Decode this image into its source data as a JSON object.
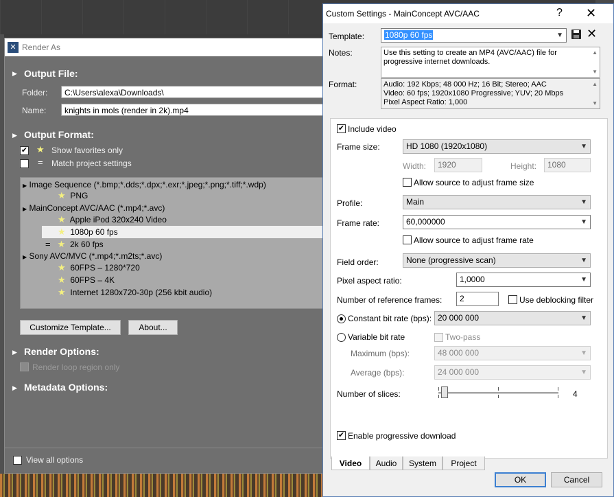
{
  "render_as": {
    "title": "Render As",
    "output_file": {
      "heading": "Output File:",
      "folder_label": "Folder:",
      "folder_value": "C:\\Users\\alexa\\Downloads\\",
      "name_label": "Name:",
      "name_value": "knights in mols (render in 2k).mp4"
    },
    "output_format": {
      "heading": "Output Format:",
      "show_favorites": "Show favorites only",
      "match_project": "Match project settings"
    },
    "tree": [
      {
        "label": "Image Sequence (*.bmp;*.dds;*.dpx;*.exr;*.jpeg;*.png;*.tiff;*.wdp)"
      },
      {
        "label": "PNG"
      },
      {
        "label": "MainConcept AVC/AAC (*.mp4;*.avc)"
      },
      {
        "label": "Apple iPod 320x240 Video"
      },
      {
        "label": "1080p 60 fps"
      },
      {
        "label": "2k 60 fps"
      },
      {
        "label": "Sony AVC/MVC (*.mp4;*.m2ts;*.avc)"
      },
      {
        "label": "60FPS – 1280*720"
      },
      {
        "label": "60FPS – 4K"
      },
      {
        "label": "Internet 1280x720-30p (256 kbit audio)"
      }
    ],
    "customize_button": "Customize Template...",
    "about_button": "About...",
    "render_options": "Render Options:",
    "render_loop": "Render loop region only",
    "metadata_options": "Metadata Options:",
    "view_all": "View all options"
  },
  "custom": {
    "title": "Custom Settings - MainConcept AVC/AAC",
    "help": "?",
    "close": "✕",
    "template_label": "Template:",
    "template_value": "1080p 60 fps",
    "notes_label": "Notes:",
    "notes_value": "Use this setting to create an MP4 (AVC/AAC) file for progressive internet downloads.",
    "format_label": "Format:",
    "format_lines": [
      "Audio: 192 Kbps; 48 000 Hz; 16 Bit; Stereo; AAC",
      "Video: 60 fps; 1920x1080 Progressive; YUV; 20 Mbps",
      "Pixel Aspect Ratio: 1,000"
    ],
    "include_video": "Include video",
    "frame_size_label": "Frame size:",
    "frame_size_value": "HD 1080 (1920x1080)",
    "width_label": "Width:",
    "width_value": "1920",
    "height_label": "Height:",
    "height_value": "1080",
    "allow_frame_size": "Allow source to adjust frame size",
    "profile_label": "Profile:",
    "profile_value": "Main",
    "frame_rate_label": "Frame rate:",
    "frame_rate_value": "60,000000",
    "allow_frame_rate": "Allow source to adjust frame rate",
    "field_order_label": "Field order:",
    "field_order_value": "None (progressive scan)",
    "par_label": "Pixel aspect ratio:",
    "par_value": "1,0000",
    "ref_frames_label": "Number of reference frames:",
    "ref_frames_value": "2",
    "deblocking": "Use deblocking filter",
    "cbr_label": "Constant bit rate (bps):",
    "cbr_value": "20 000 000",
    "vbr_label": "Variable bit rate",
    "two_pass": "Two-pass",
    "max_label": "Maximum (bps):",
    "max_value": "48 000 000",
    "avg_label": "Average (bps):",
    "avg_value": "24 000 000",
    "slices_label": "Number of slices:",
    "slices_value": "4",
    "slices_fraction": 0.05,
    "progressive": "Enable progressive download",
    "tabs": [
      "Video",
      "Audio",
      "System",
      "Project"
    ],
    "ok": "OK",
    "cancel": "Cancel"
  },
  "colors": {
    "selection": "#3390ff",
    "accent": "#3c7fd1"
  }
}
